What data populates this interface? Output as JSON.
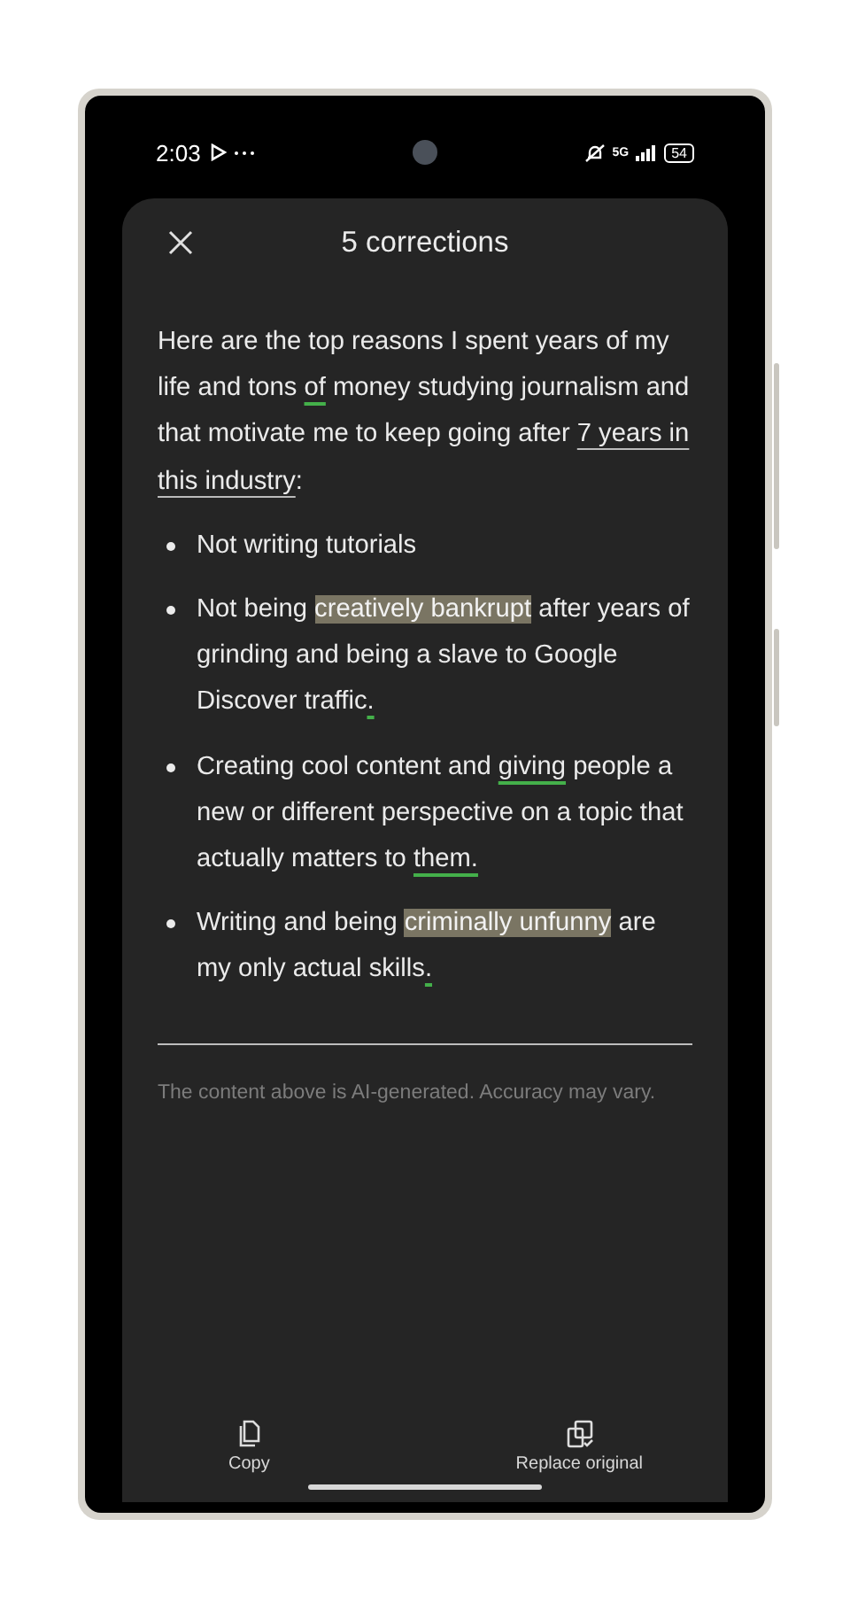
{
  "status_bar": {
    "time": "2:03",
    "network": "5G",
    "battery": "54"
  },
  "sheet": {
    "title": "5 corrections",
    "intro": [
      {
        "kind": "plain",
        "text": "Here are the top reasons I spent years of my life and tons "
      },
      {
        "kind": "fix",
        "text": "of"
      },
      {
        "kind": "plain",
        "text": " money studying journalism and that motivate me to keep going after "
      },
      {
        "kind": "link",
        "text": "7 years in this industry"
      },
      {
        "kind": "plain",
        "text": ":"
      }
    ],
    "bullets": [
      [
        {
          "kind": "plain",
          "text": "Not writing tutorials"
        }
      ],
      [
        {
          "kind": "plain",
          "text": "Not being "
        },
        {
          "kind": "highlight",
          "text": "creatively bankrupt"
        },
        {
          "kind": "plain",
          "text": " after years of grinding and being a slave to Google Discover traffic"
        },
        {
          "kind": "fix",
          "text": "."
        }
      ],
      [
        {
          "kind": "plain",
          "text": "Creating cool content and "
        },
        {
          "kind": "fix",
          "text": "giving"
        },
        {
          "kind": "plain",
          "text": " people a new or different perspective on a topic that actually matters to "
        },
        {
          "kind": "fix",
          "text": "them."
        }
      ],
      [
        {
          "kind": "plain",
          "text": "Writing and being "
        },
        {
          "kind": "highlight",
          "text": "criminally unfunny"
        },
        {
          "kind": "plain",
          "text": " are my only actual skills"
        },
        {
          "kind": "fix",
          "text": "."
        }
      ]
    ],
    "disclaimer": "The content above is AI-generated. Accuracy may vary.",
    "actions": [
      {
        "kind": "copy",
        "label": "Copy"
      },
      {
        "kind": "replace",
        "label": "Replace original"
      }
    ]
  }
}
